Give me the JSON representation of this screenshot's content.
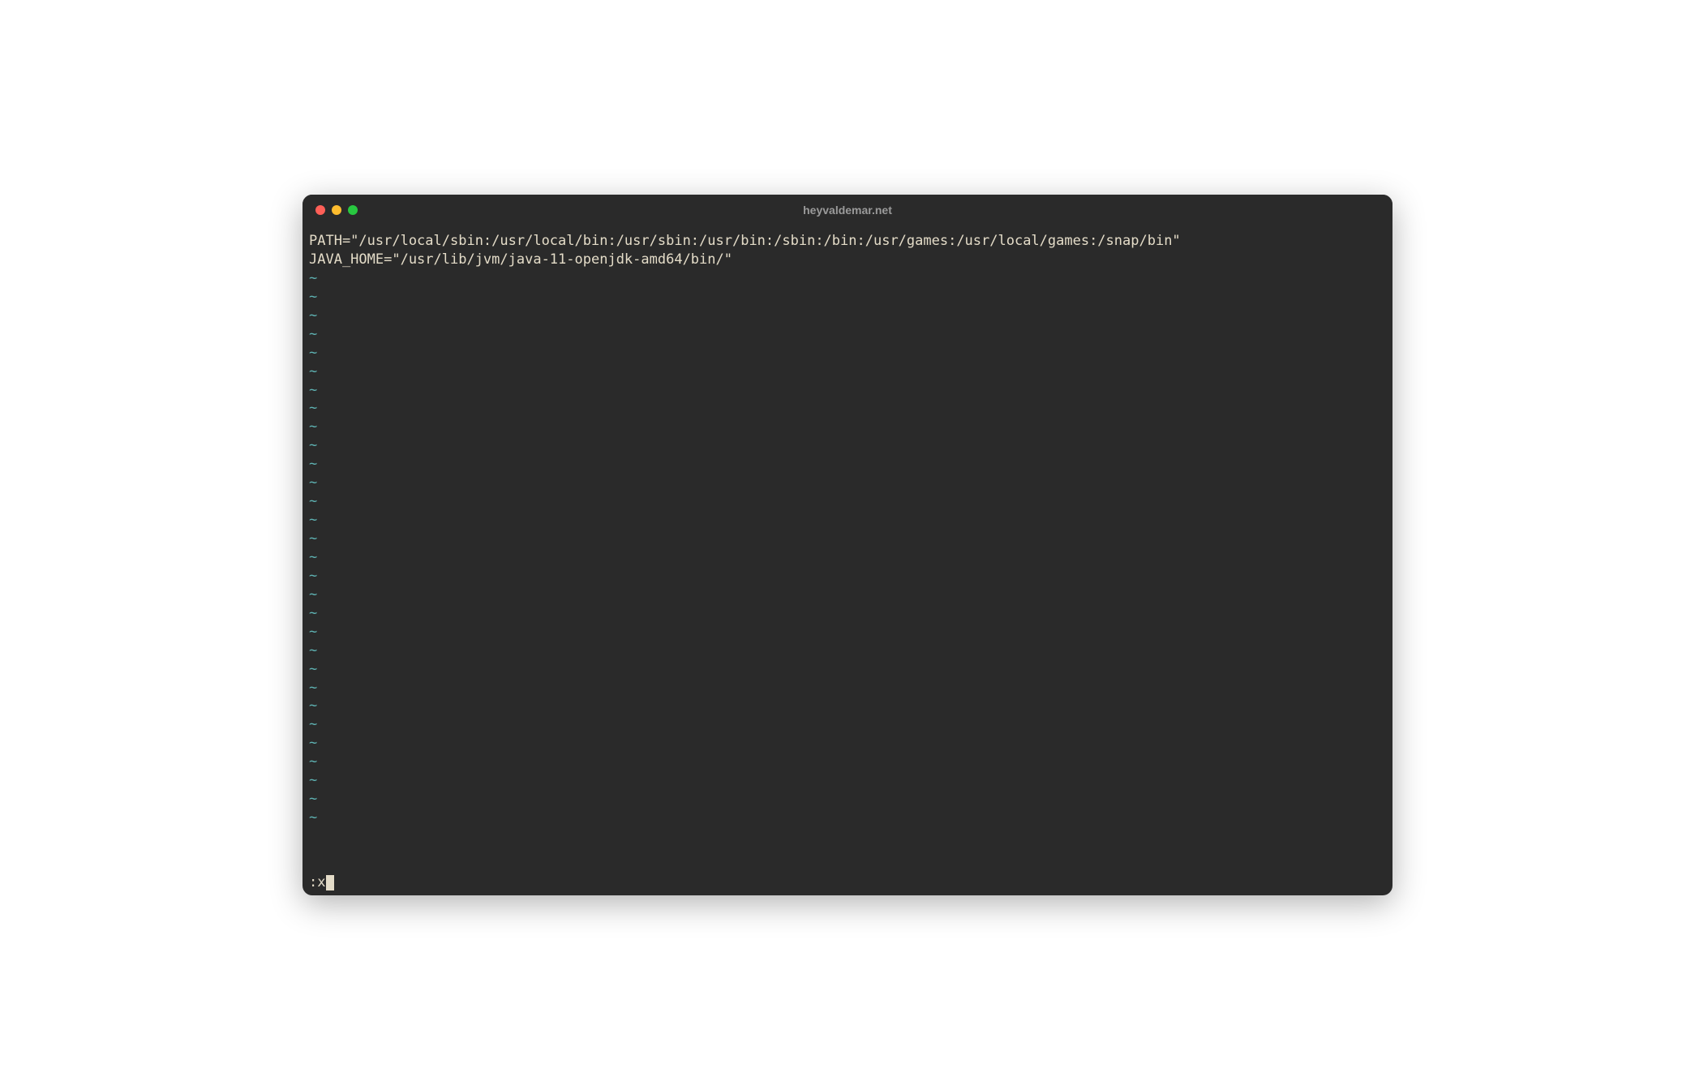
{
  "window": {
    "title": "heyvaldemar.net"
  },
  "editor": {
    "lines": [
      "PATH=\"/usr/local/sbin:/usr/local/bin:/usr/sbin:/usr/bin:/sbin:/bin:/usr/games:/usr/local/games:/snap/bin\"",
      "JAVA_HOME=\"/usr/lib/jvm/java-11-openjdk-amd64/bin/\""
    ],
    "tilde_char": "~",
    "tilde_count": 30
  },
  "command": {
    "prefix": ":",
    "text": "x"
  }
}
